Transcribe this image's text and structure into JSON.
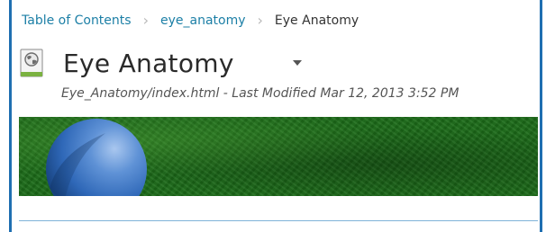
{
  "breadcrumb": {
    "items": [
      {
        "label": "Table of Contents"
      },
      {
        "label": "eye_anatomy"
      }
    ],
    "current": "Eye Anatomy",
    "separator": "›"
  },
  "page": {
    "title": "Eye Anatomy",
    "file_meta": "Eye_Anatomy/index.html - Last Modified Mar 12, 2013 3:52 PM",
    "icon": "web-page-icon",
    "menu_icon": "caret-down-icon"
  },
  "colors": {
    "link": "#1c7fa6",
    "border": "#1f6fb1",
    "banner_green": "#1b6b18",
    "sphere_blue": "#2f68b8"
  }
}
